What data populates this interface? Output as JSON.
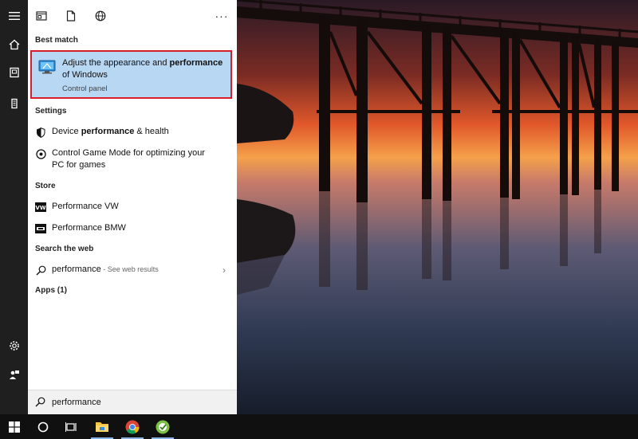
{
  "search_query": "performance",
  "sections": {
    "best_match": "Best match",
    "settings": "Settings",
    "store": "Store",
    "search_web": "Search the web",
    "apps": "Apps (1)"
  },
  "best_match": {
    "title_pre": "Adjust the appearance and ",
    "title_bold": "performance",
    "title_post": " of Windows",
    "subtitle": "Control panel"
  },
  "settings_items": [
    {
      "pre": "Device ",
      "bold": "performance",
      "post": " & health"
    },
    {
      "text": "Control Game Mode for optimizing your PC for games"
    }
  ],
  "store_items": [
    {
      "label": "Performance VW"
    },
    {
      "label": "Performance BMW"
    }
  ],
  "web_result": {
    "query": "performance",
    "hint": " - See web results"
  },
  "icons": {
    "rail": [
      "hamburger-icon",
      "home-icon",
      "document-collection-icon",
      "tower-icon",
      "gear-icon",
      "user-feedback-icon"
    ],
    "panel_top": [
      "apps-filter-icon",
      "documents-filter-icon",
      "web-filter-icon",
      "more-icon"
    ],
    "taskbar": [
      "windows-start-icon",
      "cortana-icon",
      "task-view-icon",
      "file-explorer-icon",
      "chrome-icon",
      "app-icon"
    ]
  },
  "colors": {
    "highlight": "#b8d7f3",
    "highlight_border": "#d81e2a",
    "taskbar": "#101010",
    "rail": "#1f1f1f"
  }
}
